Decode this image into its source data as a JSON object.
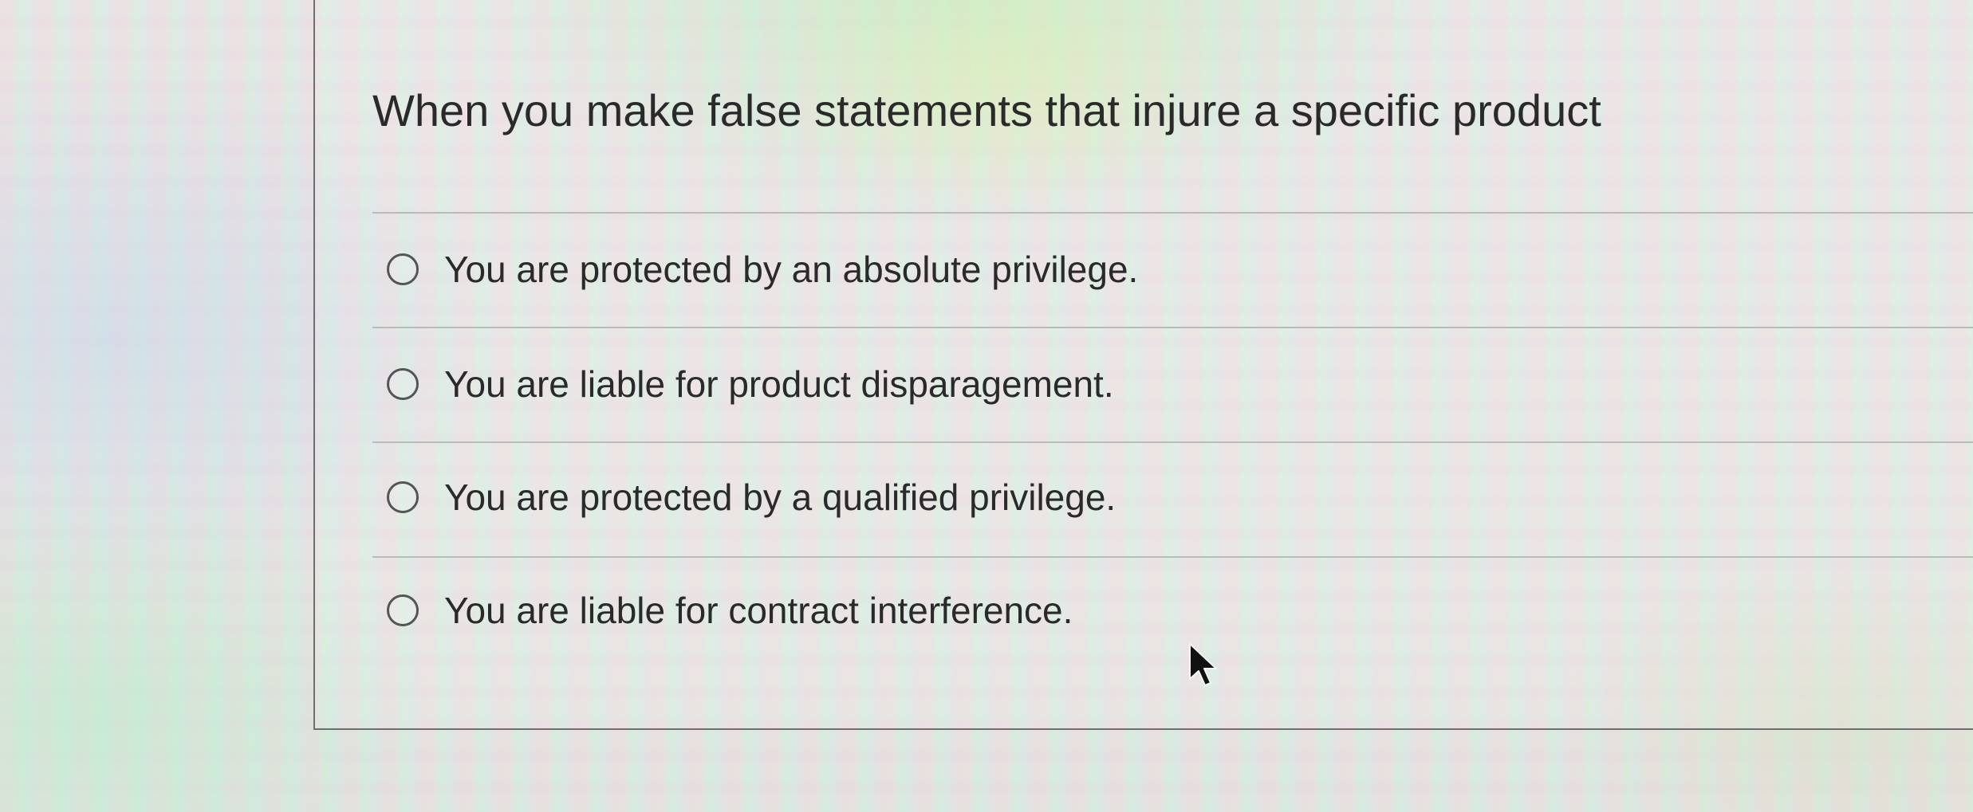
{
  "question": {
    "text": "When you make false statements that injure a specific product"
  },
  "options": [
    {
      "label": "You are protected by an absolute privilege.",
      "selected": false
    },
    {
      "label": "You are liable for product disparagement.",
      "selected": false
    },
    {
      "label": "You are protected by a qualified privilege.",
      "selected": false
    },
    {
      "label": "You are liable for contract interference.",
      "selected": false
    }
  ],
  "colors": {
    "text": "#2a2a2a",
    "divider": "#b7bcb5",
    "border": "#6e6e6e",
    "radio_border": "#555555"
  }
}
